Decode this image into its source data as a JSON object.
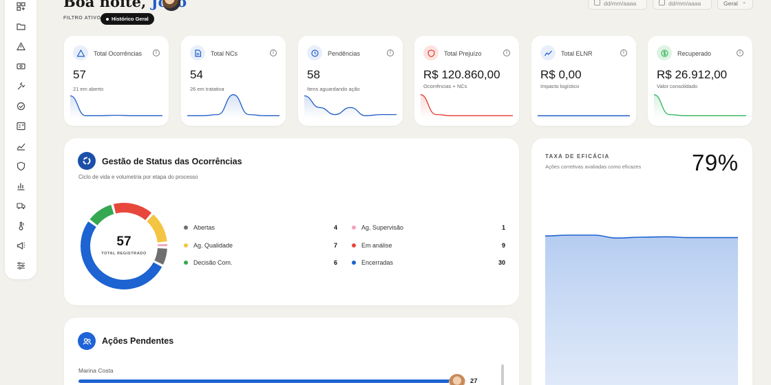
{
  "header": {
    "greeting": "Boa noite, ",
    "user_name": "João",
    "filter_label": "FILTRO ATIVO:",
    "filter_value": "Histórico Geral",
    "date_from_placeholder": "dd/mm/aaaa",
    "date_to_placeholder": "dd/mm/aaaa",
    "scope_select": "Geral"
  },
  "sidebar": {
    "icons": [
      "dashboard-icon",
      "folder-icon",
      "alert-triangle-icon",
      "money-icon",
      "gavel-icon",
      "check-circle-icon",
      "checklist-icon",
      "trend-chart-icon",
      "shield-icon",
      "bar-chart-icon",
      "truck-icon",
      "thermometer-icon",
      "megaphone-icon",
      "sliders-icon"
    ]
  },
  "kpis": [
    {
      "title": "Total Ocorrências",
      "value": "57",
      "sub": "21 em aberto",
      "icon": "alert-triangle-icon",
      "color": "#1f5cc7",
      "bg": "#e8effb",
      "trend": [
        0.1,
        0.95,
        0.95,
        0.93,
        0.95,
        0.95,
        0.95
      ]
    },
    {
      "title": "Total NCs",
      "value": "54",
      "sub": "26 em tratativa",
      "icon": "document-icon",
      "color": "#1f5cc7",
      "bg": "#e8effb",
      "trend": [
        0.95,
        0.95,
        0.9,
        0.05,
        0.9,
        0.95,
        0.95
      ]
    },
    {
      "title": "Pendências",
      "value": "58",
      "sub": "Itens aguardando ação",
      "icon": "clock-icon",
      "color": "#1f5cc7",
      "bg": "#e8effb",
      "trend": [
        0.1,
        0.6,
        0.9,
        0.6,
        0.95,
        0.9,
        0.9
      ]
    },
    {
      "title": "Total Prejuízo",
      "value": "R$ 120.860,00",
      "sub": "Ocorrências + NCs",
      "icon": "shield-icon",
      "color": "#e03b30",
      "bg": "#fbe3e1",
      "trend": [
        0.05,
        0.9,
        0.95,
        0.95,
        0.95,
        0.95,
        0.95
      ]
    },
    {
      "title": "Total ELNR",
      "value": "R$ 0,00",
      "sub": "Impacto logístico",
      "icon": "trend-icon",
      "color": "#1f5cc7",
      "bg": "#e8effb",
      "trend": [
        0.95,
        0.95,
        0.95,
        0.95,
        0.95,
        0.95,
        0.95
      ]
    },
    {
      "title": "Recuperado",
      "value": "R$ 26.912,00",
      "sub": "Valor consolidado",
      "icon": "dollar-icon",
      "color": "#2fb45a",
      "bg": "#dff3e4",
      "trend": [
        0.05,
        0.9,
        0.95,
        0.95,
        0.95,
        0.95,
        0.95
      ]
    }
  ],
  "status_panel": {
    "title": "Gestão de Status das Ocorrências",
    "subtitle": "Ciclo de vida e volumetria por etapa do processo",
    "total": "57",
    "total_label": "TOTAL REGISTRADO",
    "items": [
      {
        "label": "Abertas",
        "value": 4,
        "color": "#6f6f6f"
      },
      {
        "label": "Ag. Qualidade",
        "value": 7,
        "color": "#f4c542"
      },
      {
        "label": "Decisão Com.",
        "value": 6,
        "color": "#36a852"
      },
      {
        "label": "Ag. Supervisão",
        "value": 1,
        "color": "#f0a6be"
      },
      {
        "label": "Em análise",
        "value": 9,
        "color": "#e8473c"
      },
      {
        "label": "Encerradas",
        "value": 30,
        "color": "#1d63d1"
      }
    ]
  },
  "efficacy": {
    "title": "TAXA DE EFICÁCIA",
    "subtitle": "Ações corretivas avaliadas como eficazes",
    "percent": "79%",
    "trend": [
      0.78,
      0.8,
      0.8,
      0.73,
      0.75,
      0.76,
      0.74,
      0.74,
      0.74
    ]
  },
  "actions_panel": {
    "title": "Ações Pendentes",
    "items": [
      {
        "name": "Marina Costa",
        "count": "27",
        "fraction": 0.99
      }
    ]
  }
}
